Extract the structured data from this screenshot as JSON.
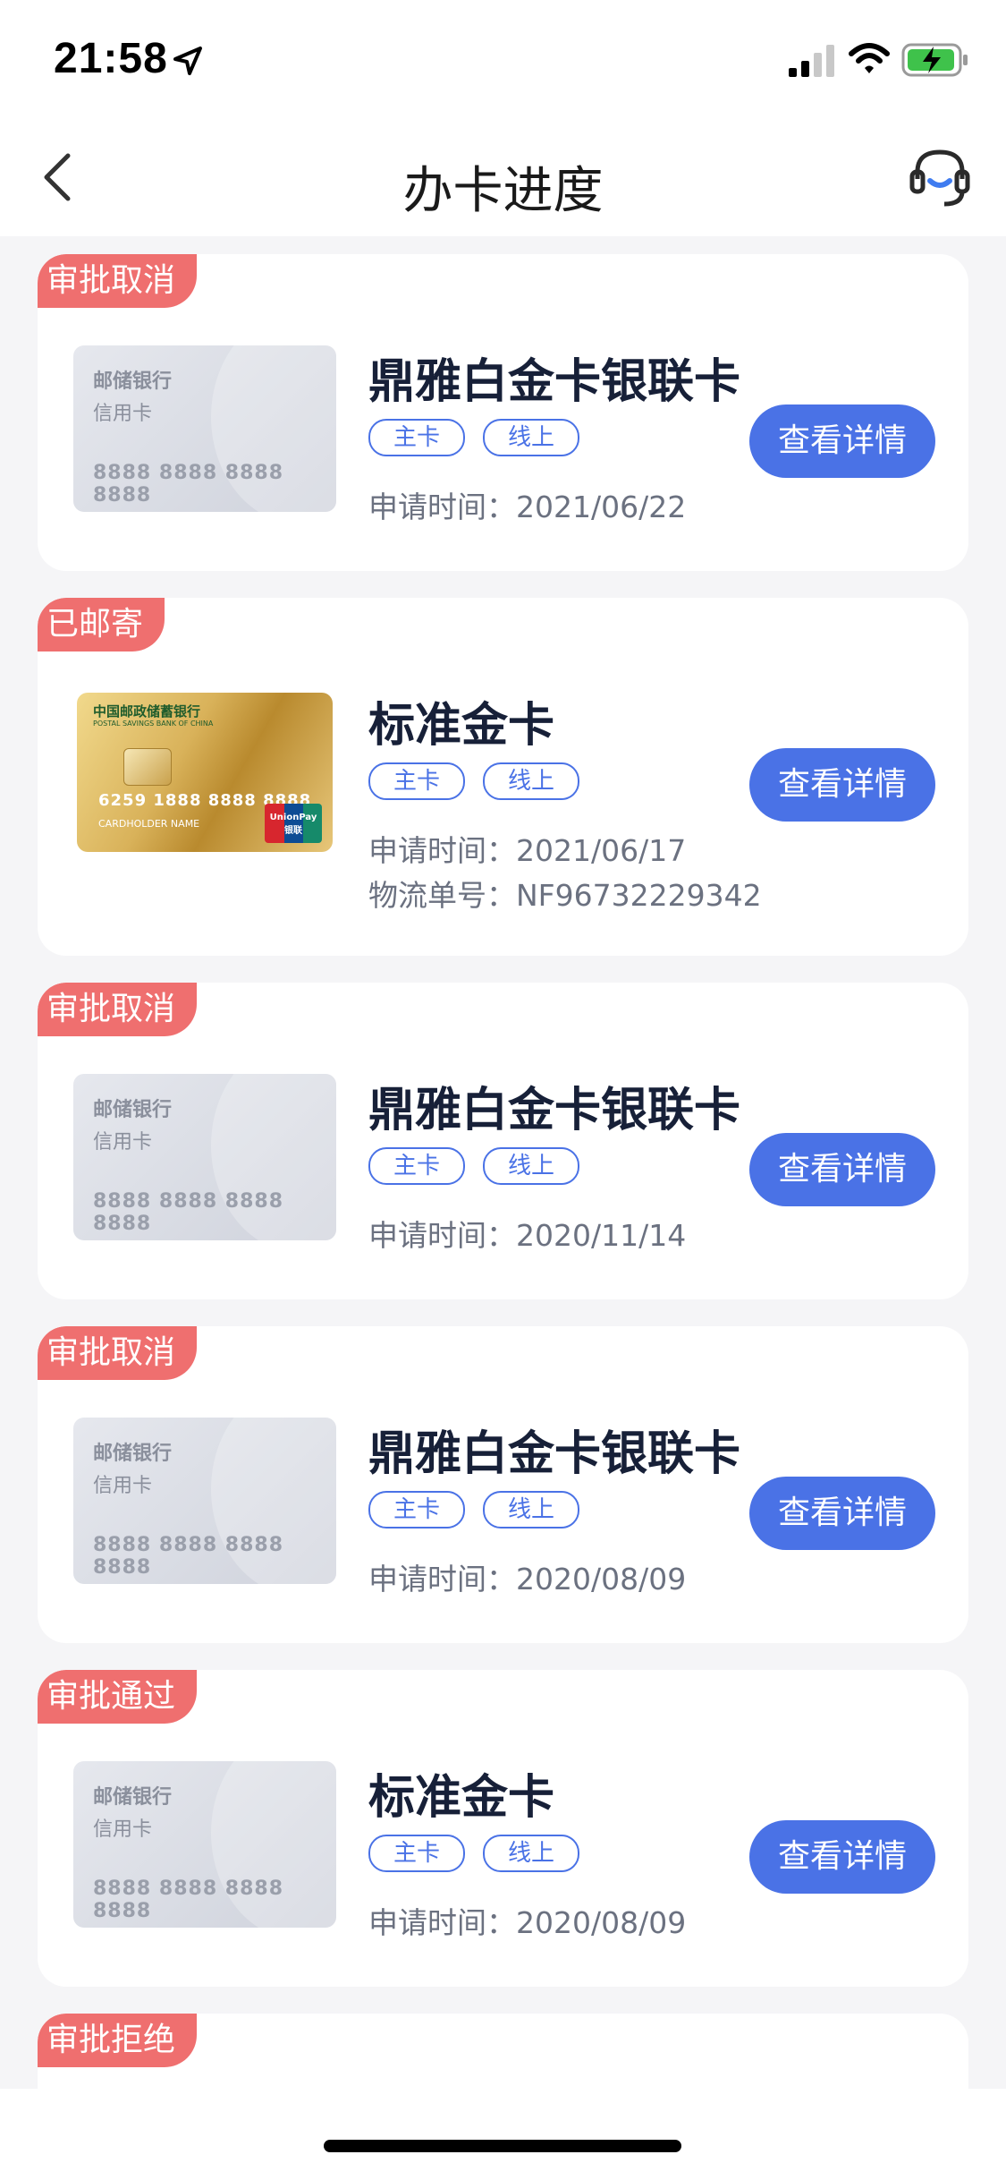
{
  "status_bar": {
    "time": "21:58"
  },
  "nav": {
    "title": "办卡进度"
  },
  "cards": [
    {
      "status": "审批取消",
      "title": "鼎雅白金卡银联卡",
      "tags": [
        "主卡",
        "线上"
      ],
      "apply_label": "申请时间：",
      "apply_date": "2021/06/22",
      "thumb": {
        "bank": "邮储银行",
        "type": "信用卡",
        "number": "8888 8888 8888 8888"
      },
      "button": "查看详情"
    },
    {
      "status": "已邮寄",
      "title": "标准金卡",
      "tags": [
        "主卡",
        "线上"
      ],
      "apply_label": "申请时间：",
      "apply_date": "2021/06/17",
      "logistics_label": "物流单号：",
      "logistics_no": "NF96732229342",
      "gold_thumb": {
        "bank_cn": "中国邮政储蓄银行",
        "bank_en": "POSTAL SAVINGS BANK OF CHINA",
        "number": "6259 1888 8888 8888",
        "holder": "CARDHOLDER NAME",
        "network": "UnionPay 银联"
      },
      "button": "查看详情"
    },
    {
      "status": "审批取消",
      "title": "鼎雅白金卡银联卡",
      "tags": [
        "主卡",
        "线上"
      ],
      "apply_label": "申请时间：",
      "apply_date": "2020/11/14",
      "thumb": {
        "bank": "邮储银行",
        "type": "信用卡",
        "number": "8888 8888 8888 8888"
      },
      "button": "查看详情"
    },
    {
      "status": "审批取消",
      "title": "鼎雅白金卡银联卡",
      "tags": [
        "主卡",
        "线上"
      ],
      "apply_label": "申请时间：",
      "apply_date": "2020/08/09",
      "thumb": {
        "bank": "邮储银行",
        "type": "信用卡",
        "number": "8888 8888 8888 8888"
      },
      "button": "查看详情"
    },
    {
      "status": "审批通过",
      "title": "标准金卡",
      "tags": [
        "主卡",
        "线上"
      ],
      "apply_label": "申请时间：",
      "apply_date": "2020/08/09",
      "thumb": {
        "bank": "邮储银行",
        "type": "信用卡",
        "number": "8888 8888 8888 8888"
      },
      "button": "查看详情"
    },
    {
      "status": "审批拒绝"
    }
  ]
}
